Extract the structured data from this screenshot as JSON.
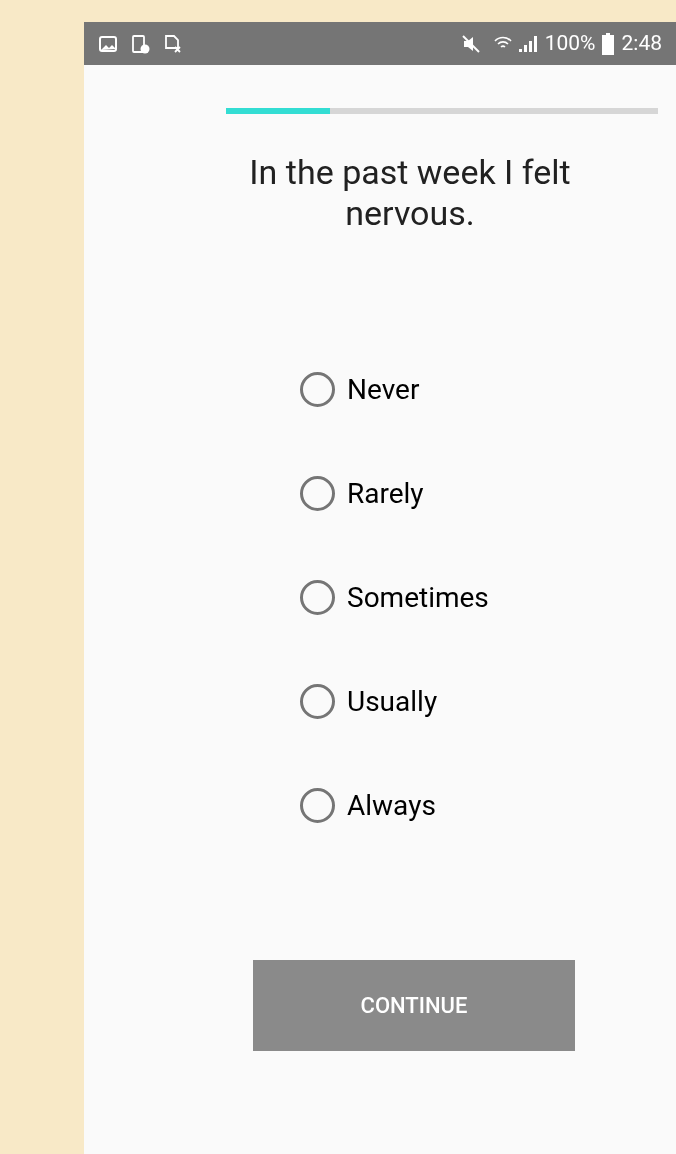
{
  "status_bar": {
    "battery": "100%",
    "time": "2:48"
  },
  "progress": {
    "level": 0.24
  },
  "question": "In the past week I felt nervous.",
  "options": [
    {
      "label": "Never",
      "selected": false
    },
    {
      "label": "Rarely",
      "selected": false
    },
    {
      "label": "Sometimes",
      "selected": false
    },
    {
      "label": "Usually",
      "selected": false
    },
    {
      "label": "Always",
      "selected": false
    }
  ],
  "continue_button": {
    "label": "CONTINUE",
    "disabled": true
  }
}
